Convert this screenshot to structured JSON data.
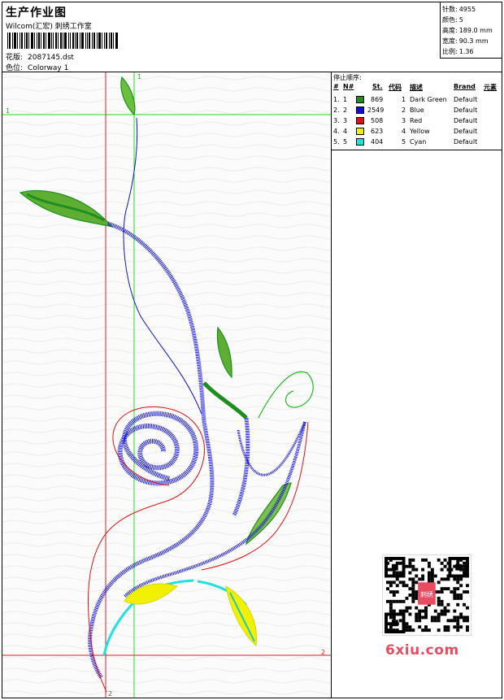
{
  "header": {
    "title": "生产作业图",
    "company": "Wilcom(汇宏) 刺绣工作室",
    "design_label": "花版:",
    "design_value": "2087145.dst",
    "color_label": "色位:",
    "color_value": "Colorway 1"
  },
  "stats": {
    "stitches_label": "针数:",
    "stitches_value": "4955",
    "colors_label": "颜色:",
    "colors_value": "5",
    "height_label": "高度:",
    "height_value": "189.0 mm",
    "width_label": "宽度:",
    "width_value": "90.3 mm",
    "scale_label": "比例:",
    "scale_value": "1.36"
  },
  "stop_sequence": {
    "title": "停止顺序:",
    "columns": [
      "#",
      "N#",
      "St.",
      "代码",
      "描述",
      "Brand",
      "元素"
    ],
    "rows": [
      {
        "num": "1.",
        "needle": "1",
        "color": "#1e8f1e",
        "stitches": "869",
        "code": "1",
        "desc": "Dark Green",
        "brand": "Default"
      },
      {
        "num": "2.",
        "needle": "2",
        "color": "#1010d8",
        "stitches": "2549",
        "code": "2",
        "desc": "Blue",
        "brand": "Default"
      },
      {
        "num": "3.",
        "needle": "3",
        "color": "#e01010",
        "stitches": "508",
        "code": "3",
        "desc": "Red",
        "brand": "Default"
      },
      {
        "num": "4.",
        "needle": "4",
        "color": "#f0f000",
        "stitches": "623",
        "code": "4",
        "desc": "Yellow",
        "brand": "Default"
      },
      {
        "num": "5.",
        "needle": "5",
        "color": "#20e0e0",
        "stitches": "404",
        "code": "5",
        "desc": "Cyan",
        "brand": "Default"
      }
    ]
  },
  "guides": {
    "v_green_label": "1",
    "h_green_label": "1",
    "h_red_label": "2",
    "v_red_label": "2"
  },
  "watermark": {
    "site": "6xiu.com",
    "stamp": "刺绣"
  }
}
